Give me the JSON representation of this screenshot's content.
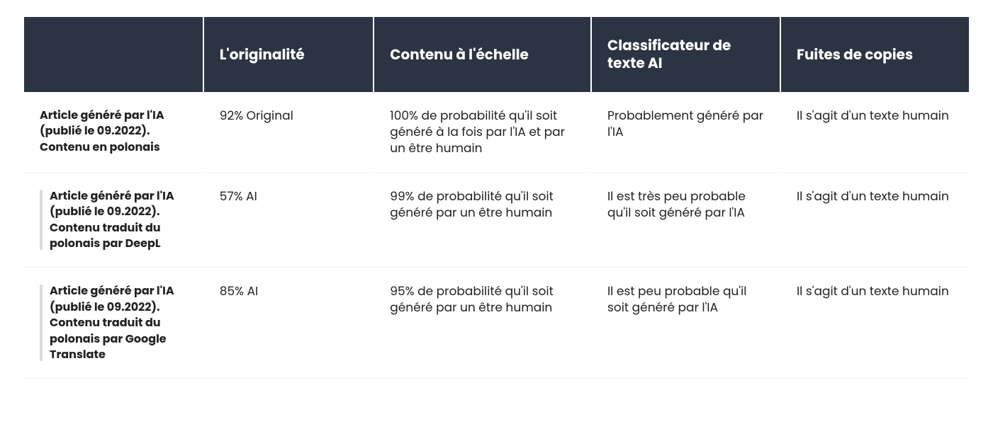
{
  "headers": {
    "col0": "",
    "col1": "L'originalité",
    "col2": "Contenu à l'échelle",
    "col3": "Classificateur de texte AI",
    "col4": "Fuites de copies"
  },
  "rows": [
    {
      "quoted": false,
      "label": "Article généré par l'IA (publié le 09.2022). Contenu en polonais",
      "originality": "92% Original",
      "scale": "100% de probabilité qu'il soit généré à la fois par l'IA et par un être humain",
      "classifier": "Probablement généré par l'IA",
      "leaks": "Il s'agit d'un texte humain"
    },
    {
      "quoted": true,
      "label": "Article généré par l'IA (publié le 09.2022). Contenu traduit du polonais par DeepL",
      "originality": "57% AI",
      "scale": "99% de probabilité qu'il soit généré par un être humain",
      "classifier": "Il est très peu probable qu'il soit généré par l'IA",
      "leaks": "Il s'agit d'un texte humain"
    },
    {
      "quoted": true,
      "label": "Article généré par l'IA (publié le 09.2022). Contenu traduit du polonais par Google Translate",
      "originality": "85% AI",
      "scale": "95% de probabilité qu'il soit généré par un être humain",
      "classifier": "Il est peu probable qu'il soit généré par l'IA",
      "leaks": "Il s'agit d'un texte humain"
    }
  ]
}
